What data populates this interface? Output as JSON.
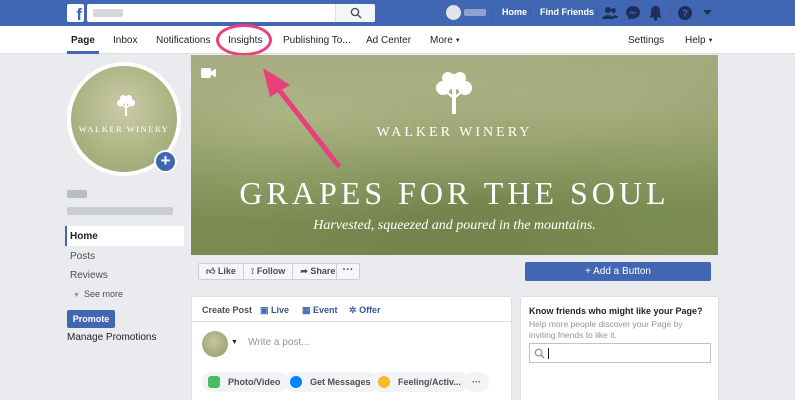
{
  "topbar": {
    "logo": "f",
    "links": [
      "Home",
      "Find Friends"
    ],
    "icons": [
      "friend-requests-icon",
      "messenger-icon",
      "notifications-bell-icon",
      "help-question-icon",
      "dropdown-caret-icon"
    ],
    "accent": "#4267b2"
  },
  "pagenav": {
    "tabs": [
      "Page",
      "Inbox",
      "Notifications",
      "Insights",
      "Publishing To...",
      "Ad Center",
      "More"
    ],
    "right_tabs": [
      "Settings",
      "Help"
    ],
    "active_tab": "Page",
    "highlighted_tab": "Insights",
    "highlight_color": "#e8407b"
  },
  "profile": {
    "brand": "WALKER WINERY"
  },
  "left_nav": {
    "items": [
      "Home",
      "Posts",
      "Reviews"
    ],
    "see_more": "See more",
    "promote": "Promote",
    "manage_promotions": "Manage Promotions"
  },
  "cover": {
    "brand": "WALKER WINERY",
    "headline": "GRAPES FOR THE SOUL",
    "tagline": "Harvested, squeezed and poured in the mountains."
  },
  "actions": {
    "like": "Like",
    "follow": "Follow",
    "share": "Share",
    "more": "···",
    "add_button": "+ Add a Button"
  },
  "create_post": {
    "tabs": [
      "Create Post",
      "Live",
      "Event",
      "Offer"
    ],
    "placeholder": "Write a post...",
    "chips": [
      "Photo/Video",
      "Get Messages",
      "Feeling/Activ...",
      "···"
    ]
  },
  "friends_card": {
    "title": "Know friends who might like your Page?",
    "description": "Help more people discover your Page by inviting friends to like it."
  }
}
